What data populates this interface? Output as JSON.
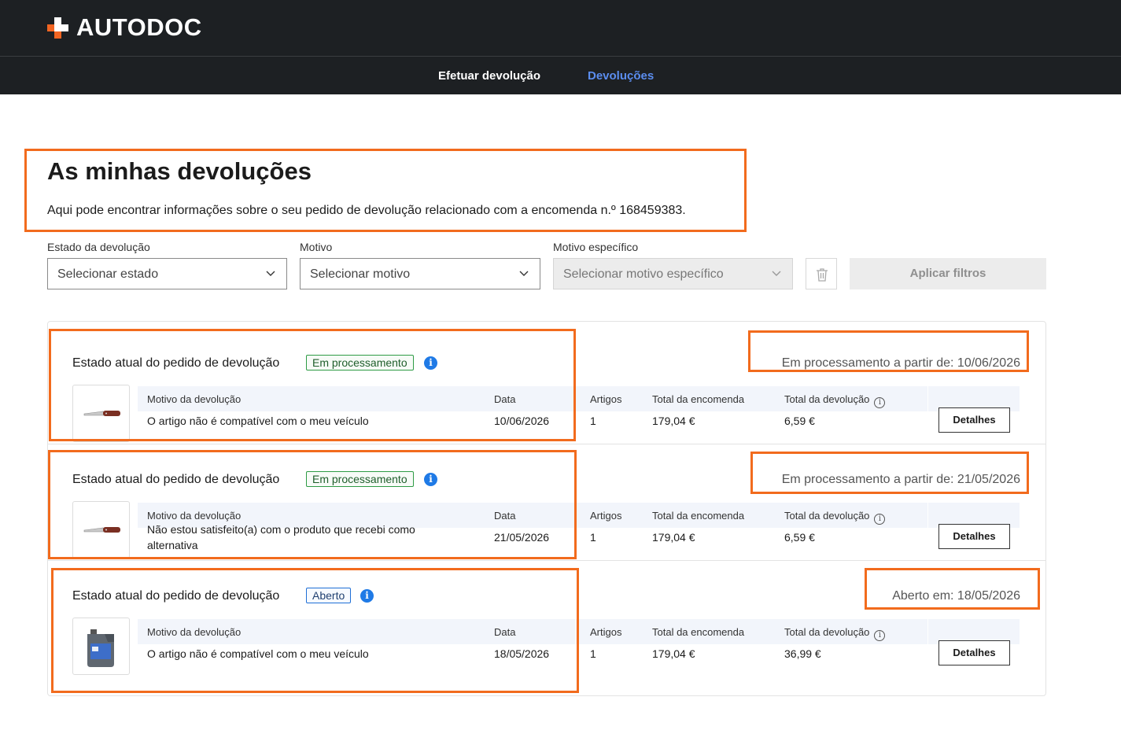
{
  "brand": {
    "name": "AUTODOC",
    "accent_color": "#f26522",
    "header_bg": "#1d2023",
    "highlight_color": "#f26b1d"
  },
  "nav": {
    "items": [
      {
        "label": "Efetuar devolução",
        "active": false
      },
      {
        "label": "Devoluções",
        "active": true
      }
    ]
  },
  "page": {
    "title": "As minhas devoluções",
    "description": "Aqui pode encontrar informações sobre o seu pedido de devolução relacionado com a encomenda n.º 168459383."
  },
  "filters": {
    "status": {
      "label": "Estado da devolução",
      "placeholder": "Selecionar estado"
    },
    "reason": {
      "label": "Motivo",
      "placeholder": "Selecionar motivo"
    },
    "specific_reason": {
      "label": "Motivo específico",
      "placeholder": "Selecionar motivo específico",
      "disabled": true
    },
    "clear_icon": "trash-icon",
    "apply_label": "Aplicar filtros"
  },
  "columns": {
    "reason": "Motivo da devolução",
    "date": "Data",
    "items": "Artigos",
    "order_total": "Total da encomenda",
    "return_total": "Total da devolução"
  },
  "returns": [
    {
      "status_label": "Estado atual do pedido de devolução",
      "status": "Em processamento",
      "status_color": "green",
      "since": "Em processamento a partir de: 10/06/2026",
      "product_icon": "knife-icon",
      "reason": "O artigo não é compatível com o meu veículo",
      "date": "10/06/2026",
      "items": "1",
      "order_total": "179,04 €",
      "return_total": "6,59 €",
      "details_label": "Detalhes"
    },
    {
      "status_label": "Estado atual do pedido de devolução",
      "status": "Em processamento",
      "status_color": "green",
      "since": "Em processamento a partir de: 21/05/2026",
      "product_icon": "knife-icon",
      "reason_line1": "Não estou satisfeito(a) com o produto que recebi como",
      "reason_line2": "alternativa",
      "date": "21/05/2026",
      "items": "1",
      "order_total": "179,04 €",
      "return_total": "6,59 €",
      "details_label": "Detalhes"
    },
    {
      "status_label": "Estado atual do pedido de devolução",
      "status": "Aberto",
      "status_color": "blue",
      "since": "Aberto em: 18/05/2026",
      "product_icon": "oil-canister-icon",
      "reason": "O artigo não é compatível com o meu veículo",
      "date": "18/05/2026",
      "items": "1",
      "order_total": "179,04 €",
      "return_total": "36,99 €",
      "details_label": "Detalhes"
    }
  ]
}
